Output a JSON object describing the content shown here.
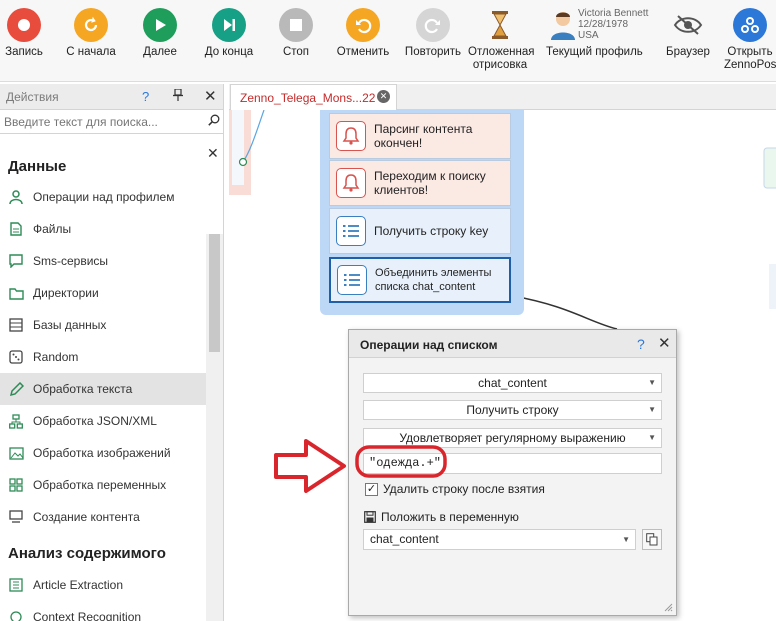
{
  "toolbar": {
    "record": "Запись",
    "restart": "С начала",
    "next": "Далее",
    "to_end": "До конца",
    "stop": "Стоп",
    "undo": "Отменить",
    "redo": "Повторить",
    "deferred_1": "Отложенная",
    "deferred_2": "отрисовка",
    "profile": "Текущий профиль",
    "browser": "Браузер",
    "open_1": "Открыть",
    "open_2": "ZennoPost",
    "profile_name": "Victoria Bennett",
    "profile_date": "12/28/1978",
    "profile_country": "USA"
  },
  "sidebar": {
    "title": "Действия",
    "help": "?",
    "pin": "🖈",
    "close": "✕",
    "search_placeholder": "Введите текст для поиска...",
    "section_data": "Данные",
    "items": [
      {
        "label": "Операции над профилем",
        "icon": "person-icon"
      },
      {
        "label": "Файлы",
        "icon": "file-icon"
      },
      {
        "label": "Sms-сервисы",
        "icon": "sms-icon"
      },
      {
        "label": "Директории",
        "icon": "folder-icon"
      },
      {
        "label": "Базы данных",
        "icon": "database-icon"
      },
      {
        "label": "Random",
        "icon": "dice-icon"
      },
      {
        "label": "Обработка текста",
        "icon": "pencil-icon"
      },
      {
        "label": "Обработка JSON/XML",
        "icon": "tree-icon"
      },
      {
        "label": "Обработка изображений",
        "icon": "image-icon"
      },
      {
        "label": "Обработка переменных",
        "icon": "grid-icon"
      },
      {
        "label": "Создание контента",
        "icon": "content-icon"
      }
    ],
    "section_analysis": "Анализ содержимого",
    "items2": [
      {
        "label": "Article Extraction",
        "icon": "article-icon"
      },
      {
        "label": "Context Recognition",
        "icon": "recognition-icon"
      }
    ]
  },
  "tab": {
    "label": "Zenno_Telega_Mons...22",
    "close": "✕"
  },
  "nodes": [
    {
      "label": "Парсинг контента окончен!",
      "icon": "bell-icon"
    },
    {
      "label": "Переходим к поиску клиентов!",
      "icon": "bell-icon"
    },
    {
      "label": "Получить строку key",
      "icon": "list-icon"
    },
    {
      "label": "Объединить элементы списка chat_content",
      "icon": "list-icon"
    }
  ],
  "dialog": {
    "title": "Операции над списком",
    "help": "?",
    "close": "✕",
    "list_name": "chat_content",
    "operation": "Получить строку",
    "condition": "Удовлетворяет регулярному выражению",
    "regex": "\"одежда.+\"",
    "delete_label": "Удалить строку после взятия",
    "delete_checked": true,
    "put_label": "Положить в переменную",
    "variable": "chat_content"
  },
  "colors": {
    "red": "#e84c3d",
    "orange": "#f39c12",
    "green": "#27ae60",
    "teal": "#16a085",
    "blue": "#2b78d8",
    "annotation": "#d9262c"
  }
}
